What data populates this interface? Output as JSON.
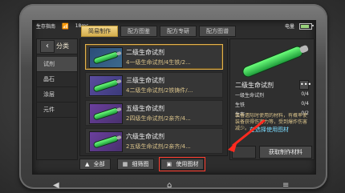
{
  "status": {
    "label": "生存指南",
    "signal": "18ms",
    "battery_fraction": 0.85,
    "battery_label": "电量"
  },
  "tabs": [
    {
      "label": "简易制作",
      "active": true
    },
    {
      "label": "配方图鉴",
      "active": false
    },
    {
      "label": "配方专研",
      "active": false
    },
    {
      "label": "配方图谱",
      "active": false
    }
  ],
  "sidebar": {
    "back_label": "‹",
    "title": "分类",
    "items": [
      {
        "label": "试剂",
        "active": true
      },
      {
        "label": "晶石",
        "active": false
      },
      {
        "label": "涂层",
        "active": false
      },
      {
        "label": "元件",
        "active": false
      }
    ]
  },
  "list": {
    "items": [
      {
        "title": "二级生命试剂",
        "sub": "4一级生命试剂/4生铁/2...",
        "active": true
      },
      {
        "title": "三级生命试剂",
        "sub": "4二级生命试剂/2铁铸件/...",
        "active": false
      },
      {
        "title": "五级生命试剂",
        "sub": "2四级生命试剂/2亲齐/4...",
        "active": false
      },
      {
        "title": "六级生命试剂",
        "sub": "2五级生命试剂/2亲齐/4...",
        "active": false
      }
    ]
  },
  "bottom": {
    "all_label": "全部",
    "fine_label": "细筛图",
    "use_label": "使用图材"
  },
  "detail": {
    "title": "二级生命试剂",
    "more_label": "•••",
    "requirements": [
      {
        "name": "一级生命试剂",
        "value": "0/4"
      },
      {
        "name": "生铁",
        "value": "0/4"
      },
      {
        "name": "生布",
        "value": "0/2"
      }
    ],
    "description": "装备遗际时使用的材料，有概率使装备获得伤害力等，受到爆炸伤害减少。",
    "get_label": "获取制作材料"
  },
  "overlay_text": "在选择使用图材"
}
